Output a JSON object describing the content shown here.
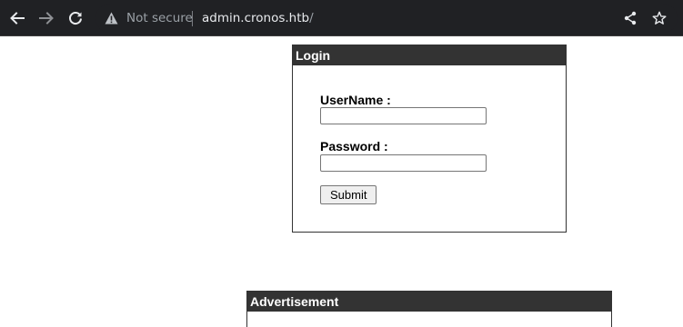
{
  "browser": {
    "security_label": "Not secure",
    "url_host": "admin.cronos.htb",
    "url_path": "/",
    "icons": {
      "back": "arrow-left-icon",
      "forward": "arrow-right-icon",
      "reload": "reload-icon",
      "warning": "warning-triangle-icon",
      "share": "share-icon",
      "bookmark": "star-icon"
    }
  },
  "login": {
    "title": "Login",
    "username_label": "UserName :",
    "username_value": "",
    "password_label": "Password :",
    "password_value": "",
    "submit_label": "Submit"
  },
  "advertisement": {
    "title": "Advertisement"
  }
}
